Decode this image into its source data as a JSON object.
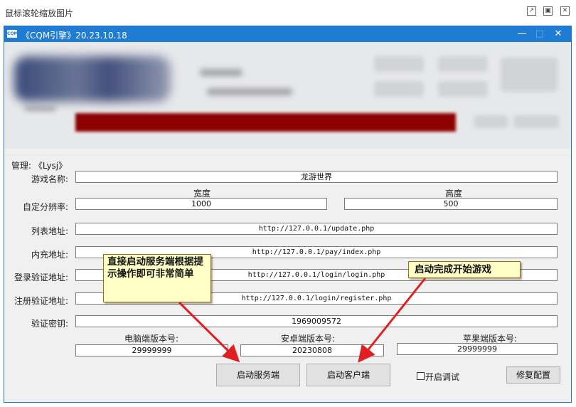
{
  "viewer": {
    "title": "鼠标滚轮缩放图片",
    "icons": [
      "external-window-icon",
      "maximize-icon",
      "close-icon"
    ]
  },
  "window": {
    "logo_text": "CQM",
    "title": "《CQM引擎》20.23.10.18",
    "controls": {
      "minimize": "—",
      "maximize": "□",
      "close": "✕"
    },
    "title_bar_color": "#1f7cd3"
  },
  "admin": "管理: 《Lysj》",
  "fields": {
    "game_name": {
      "label": "游戏名称:",
      "value": "龙游世界"
    },
    "resolution": {
      "label": "自定分辨率:",
      "width_header": "宽度",
      "width_value": "1000",
      "height_header": "高度",
      "height_value": "500"
    },
    "list_url": {
      "label": "列表地址:",
      "value": "http://127.0.0.1/update.php"
    },
    "pay_url": {
      "label": "内充地址:",
      "value": "http://127.0.0.1/pay/index.php"
    },
    "login_url": {
      "label": "登录验证地址:",
      "value": "http://127.0.0.1/login/login.php"
    },
    "register_url": {
      "label": "注册验证地址:",
      "value": "http://127.0.0.1/login/register.php"
    },
    "verify_key": {
      "label": "验证密钥:",
      "value": "1969009572"
    },
    "pc_version": {
      "label": "电脑端版本号:",
      "value": "29999999"
    },
    "android_version": {
      "label": "安卓端版本号:",
      "value": "20230808"
    },
    "ios_version": {
      "label": "苹果端版本号:",
      "value": "29999999"
    }
  },
  "buttons": {
    "start_server": "启动服务端",
    "start_client": "启动客户端",
    "enable_debug": "开启调试",
    "fix_config": "修复配置"
  },
  "annotations": {
    "left_note": "直接启动服务端根据提示操作即可非常简单",
    "right_note": "启动完成开始游戏",
    "arrow_color": "#e02020",
    "note_bg": "#ffffc6"
  },
  "colors": {
    "progress_bar": "#8c0000"
  }
}
